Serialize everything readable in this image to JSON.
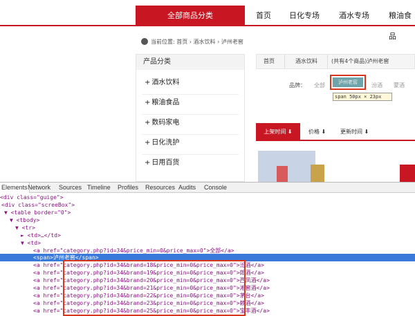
{
  "nav": {
    "all_categories": "全部商品分类",
    "items": [
      "首页",
      "日化专场",
      "酒水专场",
      "粮油食品"
    ]
  },
  "breadcrumb": {
    "prefix": "当前位置:",
    "items": [
      "首页",
      "酒水饮料",
      "泸州老窖"
    ]
  },
  "sidebar": {
    "title": "产品分类",
    "items": [
      "酒水饮料",
      "粮油食品",
      "数码家电",
      "日化洗护",
      "日用百货"
    ]
  },
  "filter": {
    "crumb": [
      "首页",
      "酒水饮料",
      "(共有4个商品)泸州老窖"
    ],
    "brand_label": "品牌：",
    "brands": [
      "全部",
      "泸州老窖",
      "汾酒",
      "蒙酒"
    ],
    "tooltip": "span 50px × 23px"
  },
  "sort": {
    "items": [
      "上架时间",
      "价格",
      "更新时间"
    ]
  },
  "devtools": {
    "tabs": [
      "Elements",
      "Network",
      "Sources",
      "Timeline",
      "Profiles",
      "Resources",
      "Audits",
      "Console"
    ],
    "lines": [
      "<div class=\"guige\">",
      "<div class=\"screeBox\">",
      "▼ <table border=\"0\">",
      "▼ <tbody>",
      "▼ <tr>",
      "► <td>…</td>",
      "▼ <td>",
      "<a href=\"category.php?id=34&price_min=0&price_max=0\">全部</a>",
      "<span>泸州老窖</span>",
      "<a href=\"category.php?id=34&brand=18&price_min=0&price_max=0\">汾酒</a>",
      "<a href=\"category.php?id=34&brand=19&price_min=0&price_max=0\">郎酒</a>",
      "<a href=\"category.php?id=34&brand=20&price_min=0&price_max=0\">西凤酒</a>",
      "<a href=\"category.php?id=34&brand=21&price_min=0&price_max=0\">湘窖酒</a>",
      "<a href=\"category.php?id=34&brand=22&price_min=0&price_max=0\">茅台</a>",
      "<a href=\"category.php?id=34&brand=23&price_min=0&price_max=0\">赖酒</a>",
      "<a href=\"category.php?id=34&brand=25&price_min=0&price_max=0\">宝丰酒</a>"
    ]
  }
}
